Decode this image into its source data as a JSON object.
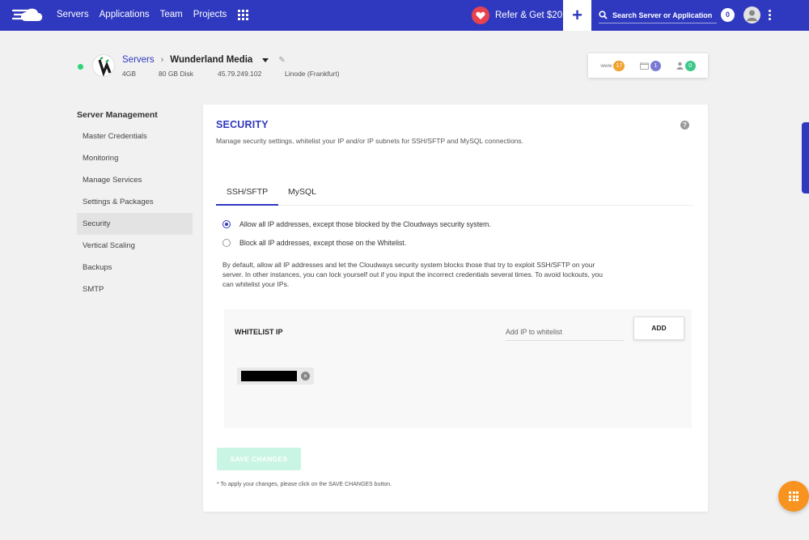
{
  "nav": {
    "items": [
      "Servers",
      "Applications",
      "Team",
      "Projects"
    ],
    "refer_label": "Refer & Get $20",
    "add_label": "+",
    "search_placeholder": "Search Server or Application",
    "notifications_count": "0"
  },
  "server": {
    "breadcrumb_root": "Servers",
    "breadcrumb_sep": "›",
    "name": "Wunderland Media",
    "ram": "4GB",
    "disk": "80 GB Disk",
    "ip": "45.79.249.102",
    "provider": "Linode (Frankfurt)"
  },
  "stats": {
    "www_label": "www",
    "apps_count": "17",
    "projects_count": "1",
    "users_count": "0"
  },
  "sidebar": {
    "title": "Server Management",
    "items": [
      {
        "label": "Master Credentials"
      },
      {
        "label": "Monitoring"
      },
      {
        "label": "Manage Services"
      },
      {
        "label": "Settings & Packages"
      },
      {
        "label": "Security"
      },
      {
        "label": "Vertical Scaling"
      },
      {
        "label": "Backups"
      },
      {
        "label": "SMTP"
      }
    ],
    "active_index": 4
  },
  "security": {
    "title": "SECURITY",
    "help": "?",
    "description": "Manage security settings, whitelist your IP and/or IP subnets for SSH/SFTP and MySQL connections.",
    "tabs": [
      {
        "label": "SSH/SFTP"
      },
      {
        "label": "MySQL"
      }
    ],
    "active_tab": "SSH/SFTP",
    "options": [
      {
        "label": "Allow all IP addresses, except those blocked by the Cloudways security system.",
        "selected": true
      },
      {
        "label": "Block all IP addresses, except those on the Whitelist.",
        "selected": false
      }
    ],
    "info": "By default, allow all IP addresses and let the Cloudways security system blocks those that try to exploit SSH/SFTP on your server. In other instances, you can lock yourself out if you input the incorrect credentials several times. To avoid lockouts, you can whitelist your IPs.",
    "whitelist_title": "WHITELIST IP",
    "whitelist_placeholder": "Add IP to whitelist",
    "add_label": "ADD",
    "save_label": "SAVE CHANGES",
    "footnote": "* To apply your changes, please click on the SAVE CHANGES button."
  },
  "colors": {
    "brand": "#2f39bf",
    "heart": "#e8424f",
    "status": "#2ed37a",
    "fab": "#f7931e",
    "save_disabled": "#c9f5e4"
  }
}
